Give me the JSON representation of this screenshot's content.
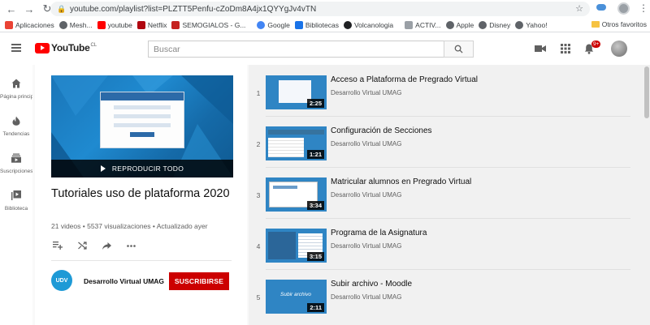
{
  "browser": {
    "url": "youtube.com/playlist?list=PLZTT5Penfu-cZoDm8A4jx1QYYgJv4vTN",
    "bookmarks": [
      {
        "label": "Aplicaciones",
        "color": "#ea4335"
      },
      {
        "label": "Mesh...",
        "color": "#5f6368"
      },
      {
        "label": "youtube",
        "color": "#ff0000"
      },
      {
        "label": "Netflix",
        "color": "#b00610"
      },
      {
        "label": "SEMOGIALOS - G...",
        "color": "#c5221f"
      },
      {
        "label": "Google",
        "color": "#4285f4"
      },
      {
        "label": "Bibliotecas",
        "color": "#1a73e8"
      },
      {
        "label": "Volcanologia",
        "color": "#202124"
      },
      {
        "label": "ACTIV...",
        "color": "#9aa0a6"
      },
      {
        "label": "Apple",
        "color": "#5f6368"
      },
      {
        "label": "Disney",
        "color": "#5f6368"
      },
      {
        "label": "Yahoo!",
        "color": "#5f6368"
      }
    ],
    "other_bookmarks": "Otros favoritos"
  },
  "masthead": {
    "logo_text": "YouTube",
    "logo_country": "CL",
    "search_placeholder": "Buscar",
    "notification_count": "9+"
  },
  "guide": [
    {
      "label": "Página principal",
      "icon": "home-icon"
    },
    {
      "label": "Tendencias",
      "icon": "trending-icon"
    },
    {
      "label": "Suscripciones",
      "icon": "subscriptions-icon"
    },
    {
      "label": "Biblioteca",
      "icon": "library-icon"
    }
  ],
  "playlist": {
    "play_all_label": "REPRODUCIR TODO",
    "title": "Tutoriales uso de plataforma 2020",
    "stats": "21 videos • 5537 visualizaciones • Actualizado ayer",
    "owner_name": "Desarrollo Virtual UMAG",
    "owner_avatar_text": "UDV",
    "subscribe_label": "SUSCRIBIRSE"
  },
  "videos": [
    {
      "index": "1",
      "title": "Acceso a Plataforma de Pregrado Virtual",
      "channel": "Desarrollo Virtual UMAG",
      "duration": "2:25"
    },
    {
      "index": "2",
      "title": "Configuración de Secciones",
      "channel": "Desarrollo Virtual UMAG",
      "duration": "1:21"
    },
    {
      "index": "3",
      "title": "Matricular alumnos en Pregrado Virtual",
      "channel": "Desarrollo Virtual UMAG",
      "duration": "3:34"
    },
    {
      "index": "4",
      "title": "Programa de la Asignatura",
      "channel": "Desarrollo Virtual UMAG",
      "duration": "3:15"
    },
    {
      "index": "5",
      "title": "Subir archivo - Moodle",
      "channel": "Desarrollo Virtual UMAG",
      "duration": "2:11",
      "thumb_text": "Subir archivo"
    }
  ]
}
